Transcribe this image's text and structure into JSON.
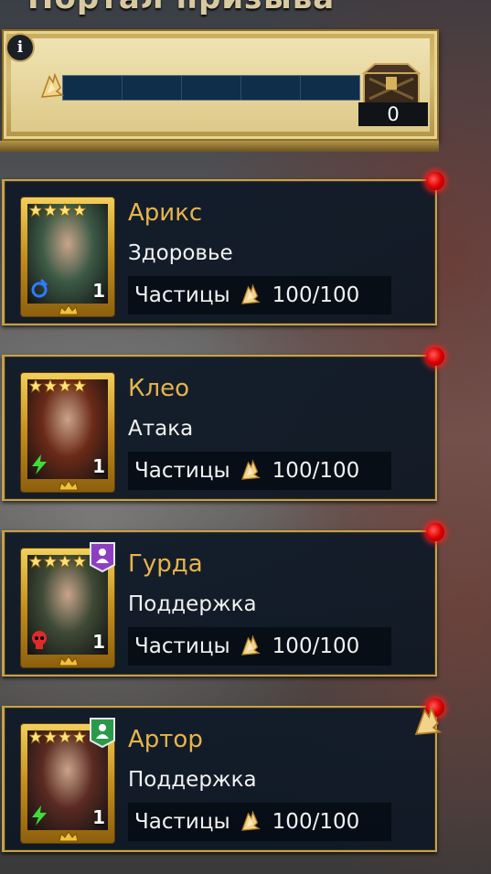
{
  "header": {
    "title": "Портал призыва"
  },
  "summon_progress": {
    "count": "0",
    "progress_fraction": 0,
    "segments": 5
  },
  "icons": {
    "info": "info-icon",
    "shard": "gold-shard-icon",
    "chest": "chest-icon",
    "notification": "red-notification-dot",
    "star": "star-icon"
  },
  "heroes": [
    {
      "name": "Арикс",
      "role": "Здоровье",
      "fragments_label": "Частицы",
      "fragments": "100/100",
      "level": "1",
      "stars": 4,
      "affinity": "magic",
      "affinity_color": "#2e7bff",
      "portrait_tone": "#3c5a46",
      "has_role_badge": false
    },
    {
      "name": "Клео",
      "role": "Атака",
      "fragments_label": "Частицы",
      "fragments": "100/100",
      "level": "1",
      "stars": 4,
      "affinity": "force",
      "affinity_color": "#3fdc3a",
      "portrait_tone": "#6b2a18",
      "has_role_badge": false
    },
    {
      "name": "Гурда",
      "role": "Поддержка",
      "fragments_label": "Частицы",
      "fragments": "100/100",
      "level": "1",
      "stars": 4,
      "affinity": "void",
      "affinity_color": "#e02a2a",
      "portrait_tone": "#3e4a36",
      "has_role_badge": true,
      "role_badge_color": "#8e3fc0"
    },
    {
      "name": "Артор",
      "role": "Поддержка",
      "fragments_label": "Частицы",
      "fragments": "100/100",
      "level": "1",
      "stars": 4,
      "affinity": "force",
      "affinity_color": "#3fdc3a",
      "portrait_tone": "#5a2a22",
      "has_role_badge": true,
      "role_badge_color": "#2a9a4a"
    }
  ],
  "colors": {
    "gold_accent": "#c5a24a",
    "name_color": "#e6b44c",
    "panel_bg": "#0e1824",
    "notification": "#e00000"
  }
}
